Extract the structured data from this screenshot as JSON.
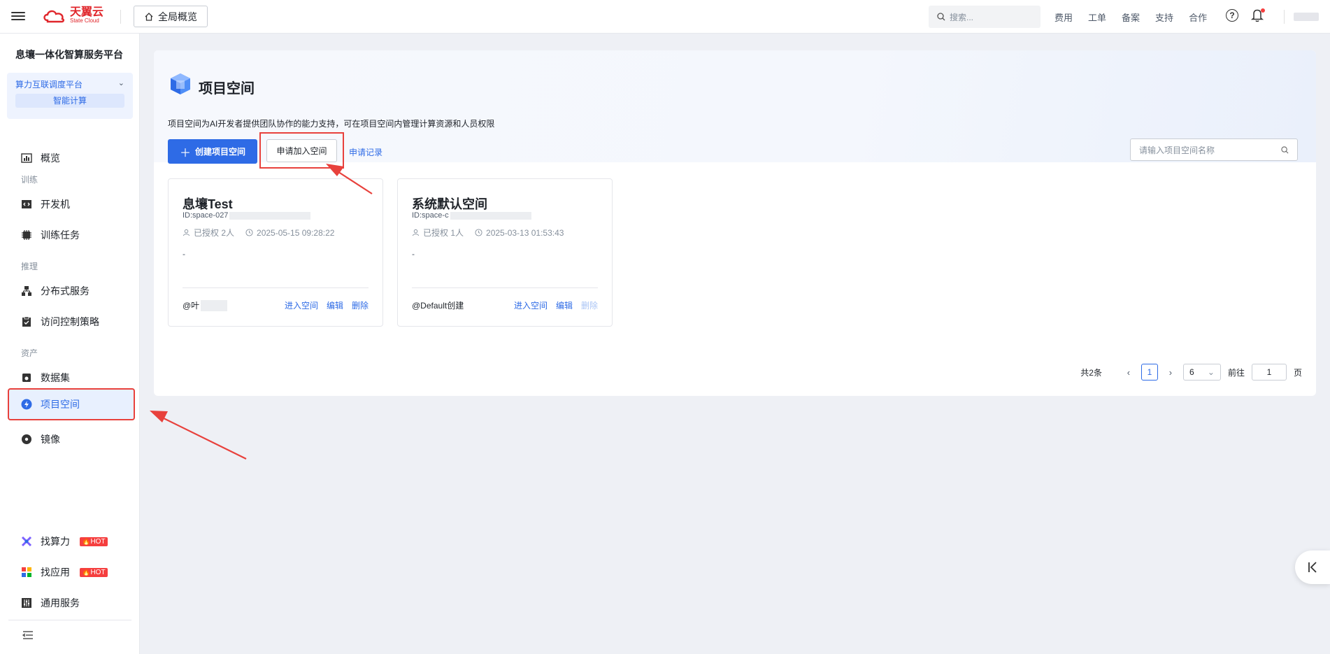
{
  "topbar": {
    "logo_cn": "天翼云",
    "logo_en": "State Cloud",
    "home_label": "全局概览",
    "search_placeholder": "搜索...",
    "links": [
      "费用",
      "工单",
      "备案",
      "支持",
      "合作"
    ]
  },
  "sidebar": {
    "platform_title": "息壤一体化智算服务平台",
    "platform_select": "算力互联调度平台",
    "platform_sub": "智能计算",
    "items": {
      "overview": "概览",
      "section_train": "训练",
      "devbox": "开发机",
      "train_task": "训练任务",
      "section_infer": "推理",
      "distributed": "分布式服务",
      "access_policy": "访问控制策略",
      "section_asset": "资产",
      "dataset": "数据集",
      "project_space": "项目空间",
      "image": "镜像",
      "find_compute": "找算力",
      "find_app": "找应用",
      "general_service": "通用服务",
      "hot": "HOT"
    }
  },
  "main": {
    "title": "项目空间",
    "description": "项目空间为AI开发者提供团队协作的能力支持，可在项目空间内管理计算资源和人员权限",
    "create_button": "创建项目空间",
    "join_button": "申请加入空间",
    "record_link": "申请记录",
    "search_placeholder": "请输入项目空间名称",
    "cards": [
      {
        "name": "息壤Test",
        "id_prefix": "ID:space-027",
        "authorized": "已授权 2人",
        "created": "2025-05-15 09:28:22",
        "desc": "-",
        "owner_prefix": "@叶",
        "action_enter": "进入空间",
        "action_edit": "编辑",
        "action_delete": "删除"
      },
      {
        "name": "系统默认空间",
        "id_prefix": "ID:space-c",
        "authorized": "已授权 1人",
        "created": "2025-03-13 01:53:43",
        "desc": "-",
        "owner": "@Default创建",
        "action_enter": "进入空间",
        "action_edit": "编辑",
        "action_delete": "删除"
      }
    ],
    "pagination": {
      "total": "共2条",
      "current": "1",
      "page_size": "6",
      "goto_prefix": "前往",
      "goto_value": "1",
      "goto_suffix": "页"
    }
  },
  "colors": {
    "primary": "#2e6be6",
    "annotation_red": "#e8413c",
    "logo_red": "#e0262b"
  }
}
